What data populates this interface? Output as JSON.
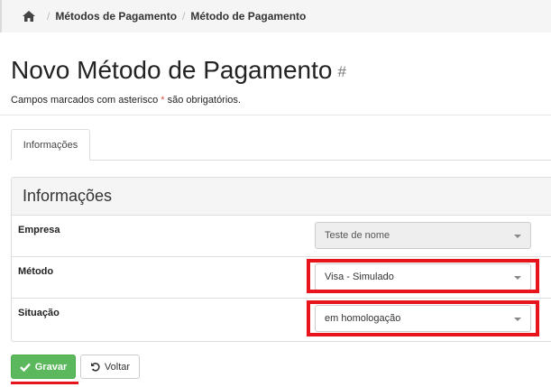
{
  "breadcrumb": {
    "home_icon": "home-icon",
    "items": [
      "Métodos de Pagamento",
      "Método de Pagamento"
    ]
  },
  "page": {
    "title": "Novo Método de Pagamento",
    "hash": "#",
    "subtitle_before": "Campos marcados com asterisco",
    "subtitle_star": "*",
    "subtitle_after": "são obrigatórios."
  },
  "tabs": [
    {
      "label": "Informações",
      "active": true
    }
  ],
  "panel": {
    "heading": "Informações",
    "fields": [
      {
        "label": "Empresa",
        "value": "Teste de nome",
        "disabled": true
      },
      {
        "label": "Método",
        "value": "Visa - Simulado",
        "disabled": false
      },
      {
        "label": "Situação",
        "value": "em homologação",
        "disabled": false
      }
    ]
  },
  "buttons": {
    "save_label": "Gravar",
    "back_label": "Voltar"
  },
  "colors": {
    "highlight": "#e8141c",
    "save": "#5cb85c"
  }
}
